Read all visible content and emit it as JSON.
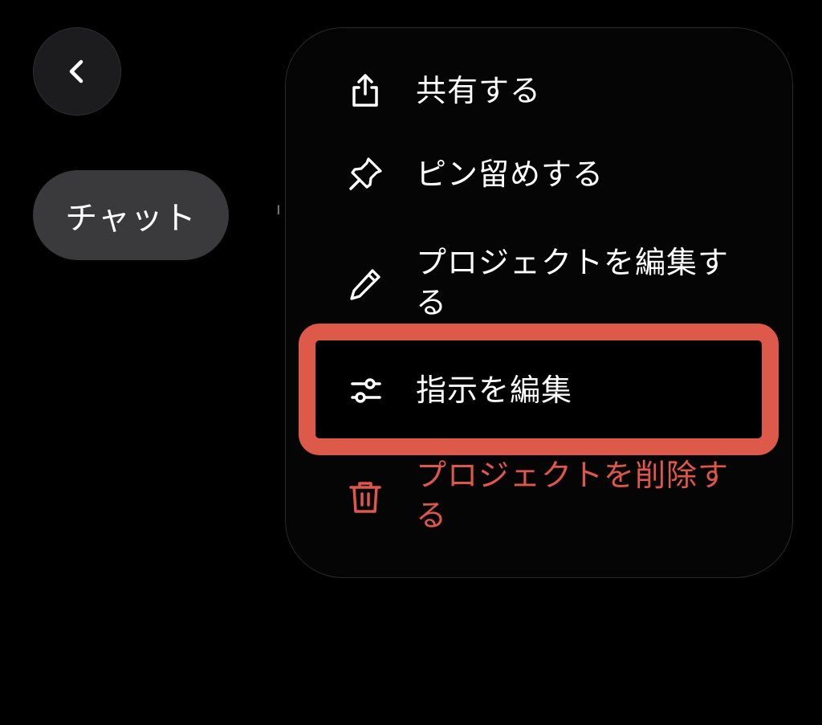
{
  "header": {
    "back_icon": "chevron-left-icon"
  },
  "chat_chip": {
    "label": "チャット"
  },
  "menu": {
    "items": [
      {
        "label": "共有する",
        "icon": "share-icon"
      },
      {
        "label": "ピン留めする",
        "icon": "pin-icon"
      },
      {
        "label": "プロジェクトを編集する",
        "icon": "pencil-icon"
      },
      {
        "label": "指示を編集",
        "icon": "sliders-icon",
        "highlighted": true
      },
      {
        "label": "プロジェクトを削除する",
        "icon": "trash-icon",
        "destructive": true
      }
    ]
  },
  "colors": {
    "background": "#000000",
    "panel": "#050505",
    "chip": "#3a3a3c",
    "highlight": "#dd5a4a",
    "destructive": "#e0564b"
  }
}
